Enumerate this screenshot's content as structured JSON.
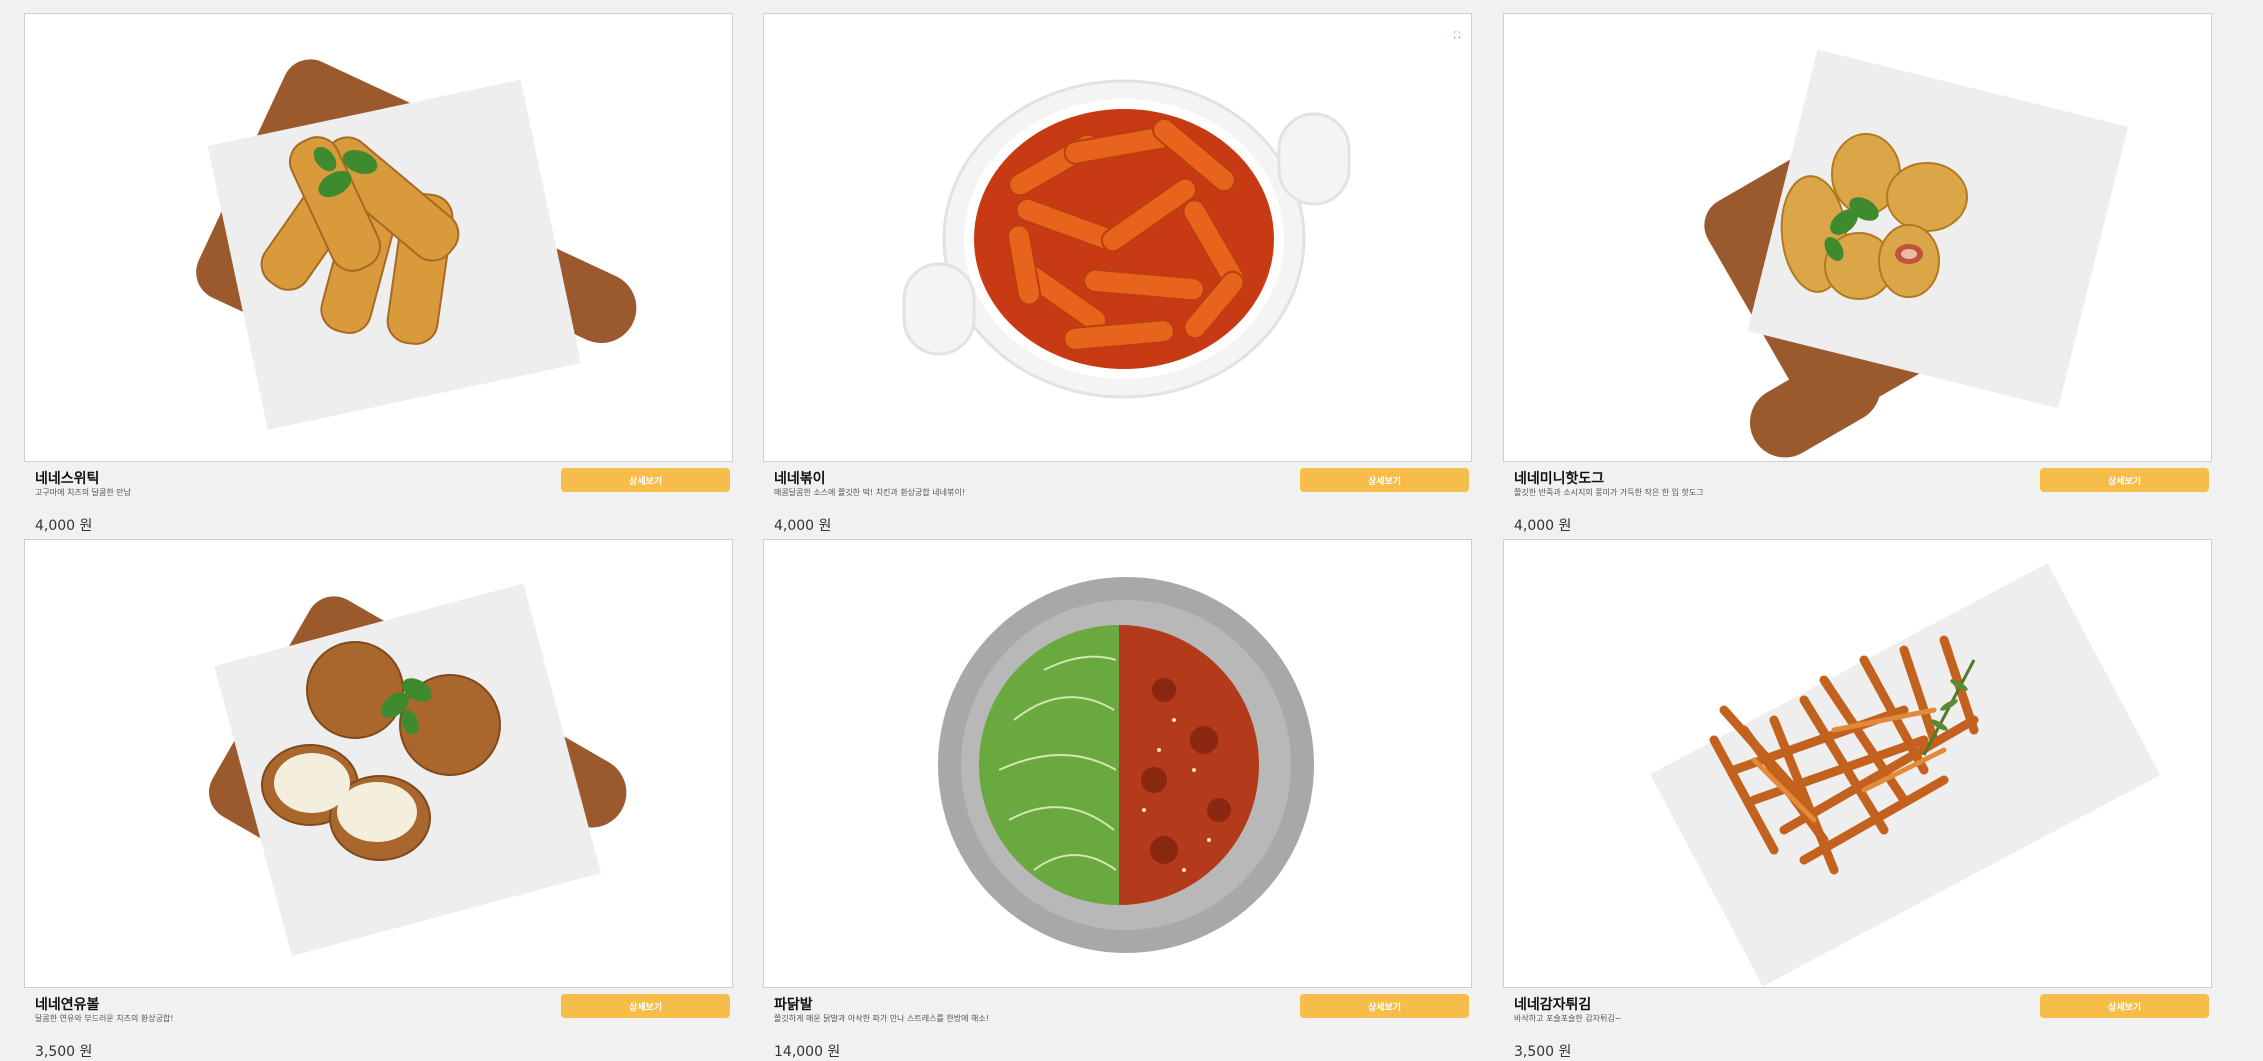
{
  "detail_label": "상세보기",
  "products": [
    {
      "name": "네네스위틱",
      "desc": "고구마에 치즈의 달콤한 만남",
      "price": "4,000 원",
      "image": "cheese-sticks"
    },
    {
      "name": "네네볶이",
      "desc": "매콤달콤한 소스에 쫄깃한 떡! 치킨과 환상궁합 네네볶이!",
      "price": "4,000 원",
      "image": "tteokbokki",
      "ad_icon": "ad-choices-icon"
    },
    {
      "name": "네네미니핫도그",
      "desc": "쫄깃한 반죽과 소시지의 풍미가 가득한 작은 한 입 핫도그",
      "price": "4,000 원",
      "image": "mini-hotdog"
    },
    {
      "name": "네네연유볼",
      "desc": "달콤한 연유와 부드러운 치즈의 환상궁합!",
      "price": "3,500 원",
      "image": "condensed-milk-balls"
    },
    {
      "name": "파닭발",
      "desc": "쫄깃하게 매운 닭발과 아삭한 파가 만나 스트레스를 한방에 해소!",
      "price": "14,000 원",
      "image": "chicken-feet-with-scallion"
    },
    {
      "name": "네네감자튀김",
      "desc": "바삭하고 포슬포슬한 감자튀김~",
      "price": "3,500 원",
      "image": "french-fries"
    }
  ]
}
